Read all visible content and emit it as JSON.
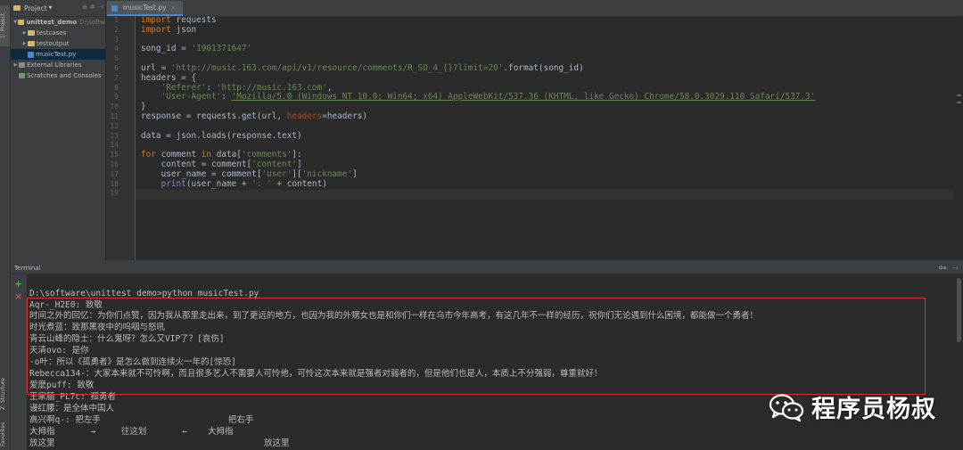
{
  "left_strip": {
    "project_tab": "1: Project",
    "structure_tab": "Z: Structure",
    "favorites_tab": "Favorites"
  },
  "project": {
    "header_label": "Project",
    "tree": [
      {
        "label": "unittest_demo",
        "path": "D:\\softw",
        "kind": "folder",
        "level": 0,
        "expanded": true
      },
      {
        "label": "testcases",
        "kind": "folder",
        "level": 1,
        "expanded": false
      },
      {
        "label": "testoutput",
        "kind": "folder",
        "level": 1,
        "expanded": false
      },
      {
        "label": "musicTest.py",
        "kind": "py",
        "level": 1,
        "selected": true
      },
      {
        "label": "External Libraries",
        "kind": "lib",
        "level": 0,
        "expanded": false
      },
      {
        "label": "Scratches and Consoles",
        "kind": "scratch",
        "level": 0,
        "expanded": false
      }
    ]
  },
  "editor": {
    "tab_label": "musicTest.py",
    "line_numbers": [
      "1",
      "2",
      "3",
      "4",
      "5",
      "6",
      "7",
      "8",
      "9",
      "10",
      "11",
      "12",
      "13",
      "14",
      "15",
      "16",
      "17",
      "18",
      "19"
    ],
    "code_lines": [
      "import requests",
      "import json",
      "",
      "song_id = '1901371647'",
      "",
      "url = 'http://music.163.com/api/v1/resource/comments/R_SO_4_{}?limit=20'.format(song_id)",
      "headers = {",
      "    'Referer': 'http://music.163.com',",
      "    'User-Agent': 'Mozilla/5.0 (Windows NT 10.0; Win64; x64) AppleWebKit/537.36 (KHTML, like Gecko) Chrome/58.0.3029.110 Safari/537.3'",
      "}",
      "response = requests.get(url, headers=headers)",
      "",
      "data = json.loads(response.text)",
      "",
      "for comment in data['comments']:",
      "    content = comment['content']",
      "    user_name = comment['user']['nickname']",
      "    print(user_name + ': ' + content)",
      ""
    ]
  },
  "terminal": {
    "title": "Terminal",
    "lines": [
      "D:\\software\\unittest_demo>python musicTest.py",
      "Aqr-_H2E0: 致敬",
      "时间之外的回忆：为你们点赞，因为我从那里走出来，到了更远的地方，也因为我的外甥女也是和你们一样在乌市今年高考，有这几年不一样的经历，祝你们无论遇到什么困境，都能做一个勇者！",
      "时光煮蓝：致那黑夜中的呜咽与怒吼",
      "青云山峰的隐士：什么鬼呀？怎么又VIP了？[哀伤]",
      "天清ovo: 是你",
      "-o叶：所以《孤勇者》是怎么做到连续火一年的[惊恐]",
      "Rebecca134-：大家本来就不可怜啊，而且很多艺人不需要人可怜他，可怜这次本来就是强者对弱者的，但是他们也是人，本质上不分强弱，尊重就好！",
      "爱麽puff: 致敬",
      "王家腼_PL7c: 孤勇者",
      "谩红腰：是全体中国人",
      "高兴啊q-: 把左手                         把右手",
      "大拇指       →     往这划       ←    大拇指",
      "放这里                                         放这里"
    ]
  },
  "watermark": {
    "text": "程序员杨叔",
    "icon": "wechat-logo-icon"
  },
  "colors": {
    "highlight_box": "#e03030",
    "keyword": "#cc7832",
    "string": "#6a8759",
    "param": "#aa4926"
  }
}
